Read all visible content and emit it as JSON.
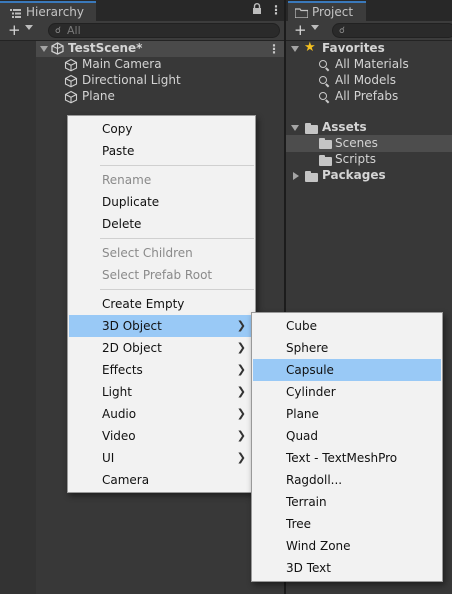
{
  "hierarchy": {
    "tab_label": "Hierarchy",
    "search_placeholder": "All",
    "scene_name": "TestScene*",
    "objects": [
      "Main Camera",
      "Directional Light",
      "Plane"
    ]
  },
  "project": {
    "tab_label": "Project",
    "favorites_label": "Favorites",
    "favorites": [
      "All Materials",
      "All Models",
      "All Prefabs"
    ],
    "assets_label": "Assets",
    "asset_folders": [
      "Scenes",
      "Scripts"
    ],
    "packages_label": "Packages"
  },
  "context_menu": {
    "groups": [
      [
        "Copy",
        "Paste"
      ],
      [
        "Rename",
        "Duplicate",
        "Delete"
      ],
      [
        "Select Children",
        "Select Prefab Root"
      ],
      [
        "Create Empty",
        "3D Object",
        "2D Object",
        "Effects",
        "Light",
        "Audio",
        "Video",
        "UI",
        "Camera"
      ]
    ],
    "disabled": [
      "Rename",
      "Select Children",
      "Select Prefab Root"
    ],
    "has_submenu": [
      "3D Object",
      "2D Object",
      "Effects",
      "Light",
      "Audio",
      "Video",
      "UI"
    ],
    "highlighted": "3D Object"
  },
  "submenu_3d_object": {
    "items": [
      "Cube",
      "Sphere",
      "Capsule",
      "Cylinder",
      "Plane",
      "Quad",
      "Text - TextMeshPro",
      "Ragdoll...",
      "Terrain",
      "Tree",
      "Wind Zone",
      "3D Text"
    ],
    "highlighted": "Capsule"
  },
  "colors": {
    "highlight": "#99c9f6",
    "menu_bg": "#f2f2f2",
    "tab_accent": "#3a79bb",
    "favorites_star": "#f4c020"
  }
}
